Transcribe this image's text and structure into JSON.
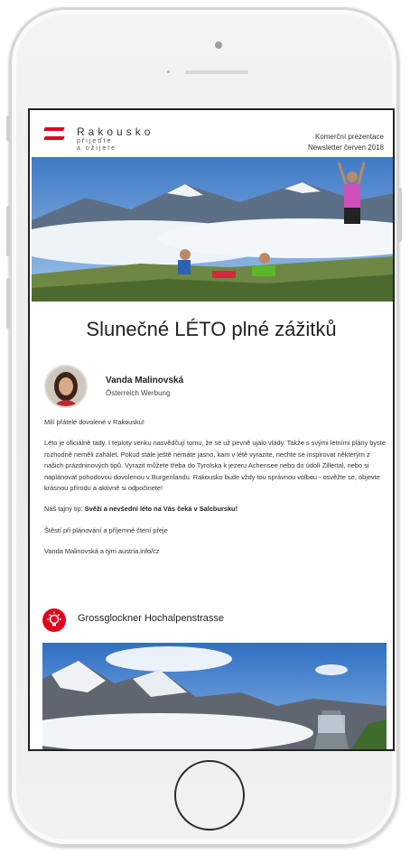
{
  "brand": {
    "name": "Rakousko",
    "tagline_1": "přijeďte",
    "tagline_2": "a ožijete"
  },
  "meta": {
    "line_1": "Komerční prezentace",
    "line_2": "Newsletter červen 2018"
  },
  "title": "Slunečné LÉTO plné zážitků",
  "author": {
    "name": "Vanda Malinovská",
    "org": "Österreich Werbung"
  },
  "body": {
    "p1": "Milí přátelé dovolené v Rakousku!",
    "p2": "Léto je oficiálně tady. I teploty venku nasvědčují tomu, že se už pevně ujalo vlády. Takže s svými letními plány byste rozhodně neměli zahálet. Pokud stále ještě nemáte jasno, kam v létě vyrazite, nechte se inspirovat některým z našich prázdninových tipů. Vyrazit můžete třeba do Tyrolska k jezeru Achensee nebo do údolí Zillertal, nebo si naplánovat pohodovou dovolenou v Burgenlandu. Rakousko bude vždy tou správnou volbou - osvěžte se, objevte krásnou přírodu a aktivně si odpočinete!",
    "p3_prefix": "Náš tajný tip: ",
    "p3_bold": "Svěží a nevšední léto na Vás čeká v Salcbursku!",
    "p4": "Štěstí při plánování a příjemné čtení přeje",
    "p5": "Vanda Malinovská a tým austria.info/cz"
  },
  "section": {
    "title": "Grossglockner Hochalpenstrasse",
    "icon": "lightbulb-icon"
  },
  "colors": {
    "accent": "#e3001b"
  }
}
